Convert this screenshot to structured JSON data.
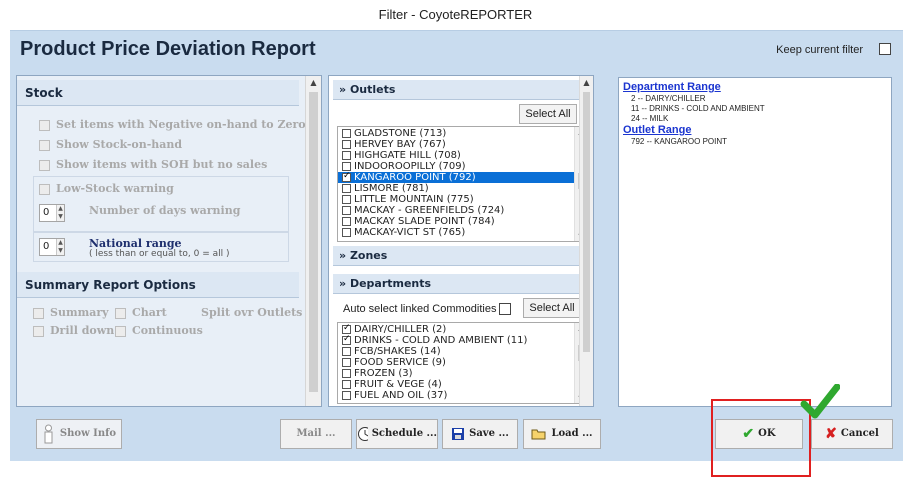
{
  "window": {
    "title": "Filter  -  CoyoteREPORTER"
  },
  "header": {
    "report_title": "Product Price Deviation Report",
    "keep_filter_label": "Keep current filter"
  },
  "stock": {
    "heading": "Stock",
    "options": [
      "Set items with Negative on-hand to Zero",
      "Show Stock-on-hand",
      "Show items with SOH but no sales"
    ],
    "low_stock_label": "Low-Stock warning",
    "days_value": "0",
    "days_label": "Number of days warning",
    "national_value": "0",
    "national_label": "National range",
    "national_note": "( less than or equal to, 0 = all )"
  },
  "summary": {
    "heading": "Summary Report Options",
    "summary_label": "Summary",
    "chart_label": "Chart",
    "split_label": "Split ovr Outlets",
    "drill_label": "Drill down",
    "continuous_label": "Continuous"
  },
  "outlets": {
    "heading": "Outlets",
    "select_all": "Select All",
    "items": [
      {
        "label": "GLADSTONE (713)",
        "checked": false,
        "selected": false
      },
      {
        "label": "HERVEY BAY (767)",
        "checked": false,
        "selected": false
      },
      {
        "label": "HIGHGATE HILL (708)",
        "checked": false,
        "selected": false
      },
      {
        "label": "INDOOROOPILLY (709)",
        "checked": false,
        "selected": false
      },
      {
        "label": "KANGAROO POINT (792)",
        "checked": true,
        "selected": true
      },
      {
        "label": "LISMORE (781)",
        "checked": false,
        "selected": false
      },
      {
        "label": "LITTLE MOUNTAIN (775)",
        "checked": false,
        "selected": false
      },
      {
        "label": "MACKAY - GREENFIELDS (724)",
        "checked": false,
        "selected": false
      },
      {
        "label": "MACKAY SLADE POINT (784)",
        "checked": false,
        "selected": false
      },
      {
        "label": "MACKAY-VICT ST (765)",
        "checked": false,
        "selected": false
      }
    ]
  },
  "zones": {
    "heading": "Zones"
  },
  "departments": {
    "heading": "Departments",
    "auto_select_label": "Auto select linked Commodities",
    "select_all": "Select All",
    "items": [
      {
        "label": "DAIRY/CHILLER (2)",
        "checked": true
      },
      {
        "label": "DRINKS - COLD AND AMBIENT (11)",
        "checked": true
      },
      {
        "label": "FCB/SHAKES (14)",
        "checked": false
      },
      {
        "label": "FOOD SERVICE (9)",
        "checked": false
      },
      {
        "label": "FROZEN (3)",
        "checked": false
      },
      {
        "label": "FRUIT & VEGE (4)",
        "checked": false
      },
      {
        "label": "FUEL AND OIL (37)",
        "checked": false
      }
    ]
  },
  "summary_panel": {
    "dept_range_title": "Department Range",
    "dept_items": [
      "2 -- DAIRY/CHILLER",
      "11 -- DRINKS - COLD AND AMBIENT",
      "24 -- MILK"
    ],
    "outlet_range_title": "Outlet Range",
    "outlet_items": [
      "792 -- KANGAROO POINT"
    ]
  },
  "footer": {
    "show_info": "Show Info",
    "mail": "Mail ...",
    "schedule": "Schedule ...",
    "save": "Save ...",
    "load": "Load ...",
    "ok": "OK",
    "cancel": "Cancel"
  },
  "colors": {
    "accent": "#0a6fd6",
    "link": "#1b35d0",
    "highlight": "#e02020",
    "check_green": "#2fa82f",
    "panel_bg": "#c9dcef"
  }
}
